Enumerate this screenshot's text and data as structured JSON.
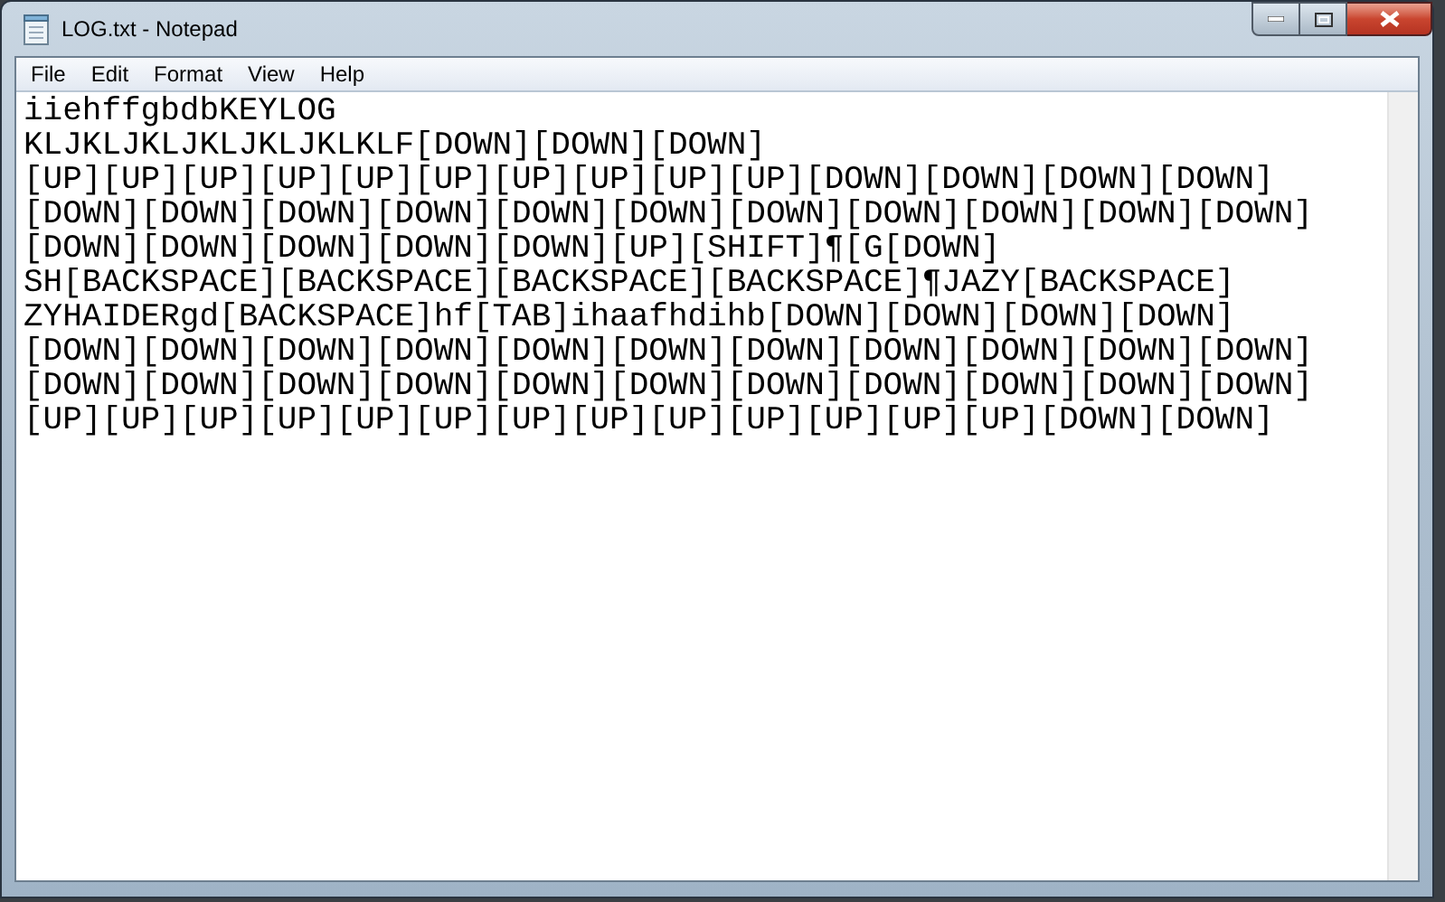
{
  "window": {
    "title": "LOG.txt - Notepad"
  },
  "menu": [
    "File",
    "Edit",
    "Format",
    "View",
    "Help"
  ],
  "document": {
    "lines": [
      "iiehffgbdbKEYLOG",
      "KLJKLJKLJKLJKLJKLKLF[DOWN][DOWN][DOWN]",
      "[UP][UP][UP][UP][UP][UP][UP][UP][UP][UP][DOWN][DOWN][DOWN][DOWN]",
      "[DOWN][DOWN][DOWN][DOWN][DOWN][DOWN][DOWN][DOWN][DOWN][DOWN][DOWN]",
      "[DOWN][DOWN][DOWN][DOWN][DOWN][UP][SHIFT]¶[G[DOWN]",
      "SH[BACKSPACE][BACKSPACE][BACKSPACE][BACKSPACE]¶JAZY[BACKSPACE]",
      "ZYHAIDERgd[BACKSPACE]hf[TAB]ihaafhdihb[DOWN][DOWN][DOWN][DOWN]",
      "[DOWN][DOWN][DOWN][DOWN][DOWN][DOWN][DOWN][DOWN][DOWN][DOWN][DOWN]",
      "[DOWN][DOWN][DOWN][DOWN][DOWN][DOWN][DOWN][DOWN][DOWN][DOWN][DOWN]",
      "[UP][UP][UP][UP][UP][UP][UP][UP][UP][UP][UP][UP][UP][DOWN][DOWN]"
    ]
  }
}
